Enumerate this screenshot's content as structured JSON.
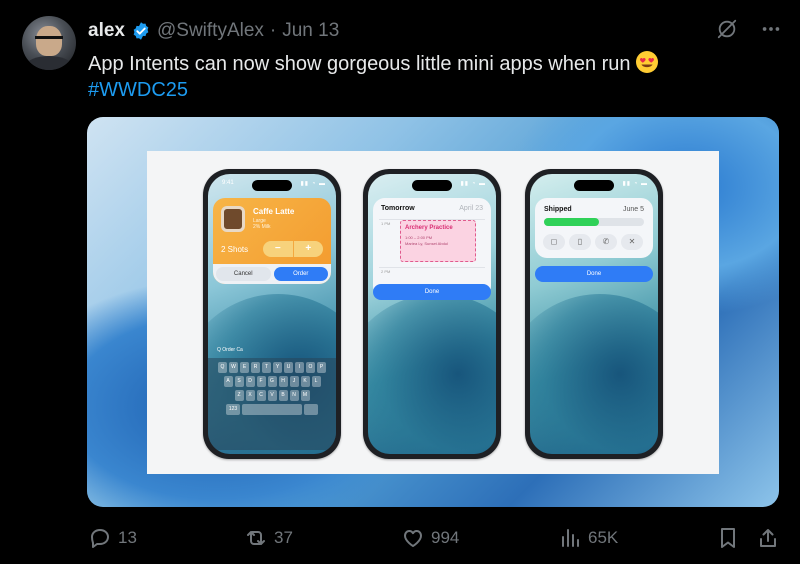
{
  "author": {
    "name": "alex",
    "handle": "@SwiftyAlex",
    "separator": "·",
    "date": "Jun 13"
  },
  "tweet": {
    "text": "App Intents can now show gorgeous little mini apps when run",
    "emoji": "smiling-face-with-heart-eyes",
    "hashtag": "#WWDC25"
  },
  "media": {
    "phone1": {
      "time": "9:41",
      "status_icons": "▮▮ ◔ ▬",
      "item_title": "Caffe Latte",
      "item_sub1": "Large",
      "item_sub2": "2% Milk",
      "shots_label": "2 Shots",
      "minus": "−",
      "plus": "+",
      "cancel": "Cancel",
      "order": "Order",
      "search_text": "Q  Order Ca",
      "keys_row1": [
        "Q",
        "W",
        "E",
        "R",
        "T",
        "Y",
        "U",
        "I",
        "O",
        "P"
      ],
      "keys_row2": [
        "A",
        "S",
        "D",
        "F",
        "G",
        "H",
        "J",
        "K",
        "L"
      ],
      "keys_row3": [
        "Z",
        "X",
        "C",
        "V",
        "B",
        "N",
        "M"
      ],
      "key_123": "123"
    },
    "phone2": {
      "status_icons": "▮▮ ◔ ▬",
      "header": "Tomorrow",
      "date": "April 23",
      "time_top": "1 PM",
      "time_bottom": "2 PM",
      "event_title": "Archery Practice",
      "event_time": "1:00 – 2:00 PM",
      "event_location": "Mariea Ly, Sunset Abdul",
      "done": "Done"
    },
    "phone3": {
      "status_icons": "▮▮ ◔ ▬",
      "title": "Shipped",
      "date": "June 5",
      "progress": 0.55,
      "done": "Done"
    }
  },
  "stats": {
    "replies": "13",
    "reposts": "37",
    "likes": "994",
    "views": "65K"
  },
  "colors": {
    "accent": "#1d9bf0",
    "muted": "#71767b",
    "verified": "#1d9bf0"
  }
}
